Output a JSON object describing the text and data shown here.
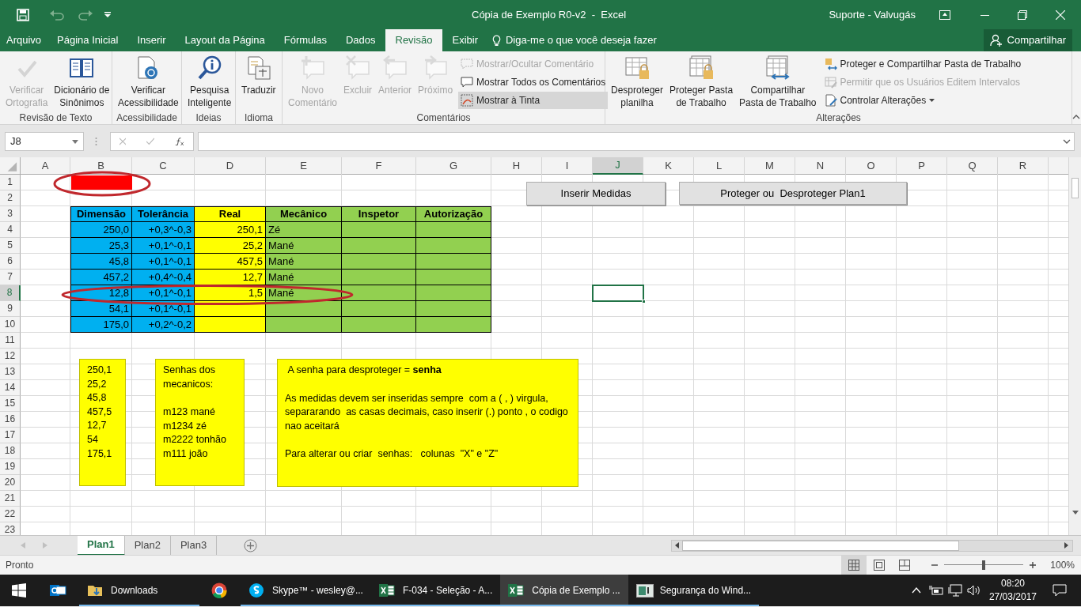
{
  "title_bar": {
    "title": "Cópia de Exemplo R0-v2  -  Excel",
    "account": "Suporte - Valvugás"
  },
  "menu_tabs": [
    {
      "label": "Arquivo",
      "selected": false
    },
    {
      "label": "Página Inicial",
      "selected": false
    },
    {
      "label": "Inserir",
      "selected": false
    },
    {
      "label": "Layout da Página",
      "selected": false
    },
    {
      "label": "Fórmulas",
      "selected": false
    },
    {
      "label": "Dados",
      "selected": false
    },
    {
      "label": "Revisão",
      "selected": true
    },
    {
      "label": "Exibir",
      "selected": false
    }
  ],
  "tell_me": "Diga-me o que você deseja fazer",
  "share_button": "Compartilhar",
  "ribbon_groups": [
    {
      "label": "Revisão de Texto",
      "commands": [
        {
          "lines": [
            "Verificar",
            "Ortografia"
          ],
          "disabled": true
        },
        {
          "lines": [
            "Dicionário de",
            "Sinônimos"
          ],
          "disabled": false
        }
      ]
    },
    {
      "label": "Acessibilidade",
      "commands": [
        {
          "lines": [
            "Verificar",
            "Acessibilidade"
          ],
          "disabled": false
        }
      ]
    },
    {
      "label": "Ideias",
      "commands": [
        {
          "lines": [
            "Pesquisa",
            "Inteligente"
          ],
          "disabled": false
        }
      ]
    },
    {
      "label": "Idioma",
      "commands": [
        {
          "lines": [
            "Traduzir"
          ],
          "disabled": false
        }
      ]
    },
    {
      "label": "Comentários",
      "commands": [
        {
          "lines": [
            "Novo",
            "Comentário"
          ],
          "disabled": true
        },
        {
          "lines": [
            "Excluir"
          ],
          "disabled": true
        },
        {
          "lines": [
            "Anterior"
          ],
          "disabled": true
        },
        {
          "lines": [
            "Próximo"
          ],
          "disabled": true
        }
      ],
      "stack": [
        {
          "label": "Mostrar/Ocultar Comentário",
          "disabled": true,
          "pressed": false,
          "dropdown": false
        },
        {
          "label": "Mostrar Todos os Comentários",
          "disabled": false,
          "pressed": false,
          "dropdown": false
        },
        {
          "label": "Mostrar à Tinta",
          "disabled": false,
          "pressed": true,
          "dropdown": false
        }
      ]
    },
    {
      "label": "Alterações",
      "commands": [
        {
          "lines": [
            "Desproteger",
            "planilha"
          ],
          "disabled": false
        },
        {
          "lines": [
            "Proteger Pasta",
            "de Trabalho"
          ],
          "disabled": false
        },
        {
          "lines": [
            "Compartilhar",
            "Pasta de Trabalho"
          ],
          "disabled": false
        }
      ],
      "stack": [
        {
          "label": "Proteger e Compartilhar Pasta de Trabalho",
          "disabled": false,
          "pressed": false,
          "dropdown": false
        },
        {
          "label": "Permitir que os Usuários Editem Intervalos",
          "disabled": true,
          "pressed": false,
          "dropdown": false
        },
        {
          "label": "Controlar Alterações",
          "disabled": false,
          "pressed": false,
          "dropdown": true
        }
      ]
    }
  ],
  "formula_bar": {
    "name_box": "J8"
  },
  "sheet": {
    "columns": [
      {
        "label": "A",
        "selected": false
      },
      {
        "label": "B",
        "selected": false
      },
      {
        "label": "C",
        "selected": false
      },
      {
        "label": "D",
        "selected": false
      },
      {
        "label": "E",
        "selected": false
      },
      {
        "label": "F",
        "selected": false
      },
      {
        "label": "G",
        "selected": false
      },
      {
        "label": "H",
        "selected": false
      },
      {
        "label": "I",
        "selected": false
      },
      {
        "label": "J",
        "selected": true
      },
      {
        "label": "K",
        "selected": false
      },
      {
        "label": "L",
        "selected": false
      },
      {
        "label": "M",
        "selected": false
      },
      {
        "label": "N",
        "selected": false
      },
      {
        "label": "O",
        "selected": false
      },
      {
        "label": "P",
        "selected": false
      },
      {
        "label": "Q",
        "selected": false
      },
      {
        "label": "R",
        "selected": false
      }
    ],
    "rows": [
      {
        "label": "1",
        "selected": false
      },
      {
        "label": "2",
        "selected": false
      },
      {
        "label": "3",
        "selected": false
      },
      {
        "label": "4",
        "selected": false
      },
      {
        "label": "5",
        "selected": false
      },
      {
        "label": "6",
        "selected": false
      },
      {
        "label": "7",
        "selected": false
      },
      {
        "label": "8",
        "selected": true
      },
      {
        "label": "9",
        "selected": false
      },
      {
        "label": "10",
        "selected": false
      },
      {
        "label": "11",
        "selected": false
      },
      {
        "label": "12",
        "selected": false
      },
      {
        "label": "13",
        "selected": false
      },
      {
        "label": "14",
        "selected": false
      },
      {
        "label": "15",
        "selected": false
      },
      {
        "label": "16",
        "selected": false
      },
      {
        "label": "17",
        "selected": false
      },
      {
        "label": "18",
        "selected": false
      },
      {
        "label": "19",
        "selected": false
      },
      {
        "label": "20",
        "selected": false
      },
      {
        "label": "21",
        "selected": false
      },
      {
        "label": "22",
        "selected": false
      },
      {
        "label": "23",
        "selected": false
      }
    ]
  },
  "table": {
    "columns": [
      {
        "title": "Dimensão",
        "color": "#00b0f0"
      },
      {
        "title": "Tolerância",
        "color": "#00b0f0"
      },
      {
        "title": "Real",
        "color": "#ffff00"
      },
      {
        "title": "Mecânico",
        "color": "#92d050"
      },
      {
        "title": "Inspetor",
        "color": "#92d050"
      },
      {
        "title": "Autorização",
        "color": "#92d050"
      }
    ],
    "rows": [
      {
        "cells": [
          "250,0",
          "+0,3^-0,3",
          "250,1",
          "Zé"
        ]
      },
      {
        "cells": [
          "25,3",
          "+0,1^-0,1",
          "25,2",
          "Mané"
        ]
      },
      {
        "cells": [
          "45,8",
          "+0,1^-0,1",
          "457,5",
          "Mané"
        ]
      },
      {
        "cells": [
          "457,2",
          "+0,4^-0,4",
          "12,7",
          "Mané"
        ]
      },
      {
        "cells": [
          "12,8",
          "+0,1^-0,1",
          "1,5",
          "Mané"
        ]
      },
      {
        "cells": [
          "54,1",
          "+0,1^-0,1"
        ]
      },
      {
        "cells": [
          "175,0",
          "+0,2^-0,2"
        ]
      }
    ]
  },
  "buttons": [
    "Inserir Medidas",
    "Proteger ou  Desproteger Plan1"
  ],
  "text_boxes": [
    {
      "paragraphs": [
        "250,1\n25,2\n45,8\n457,5\n12,7\n54\n175,1"
      ]
    },
    {
      "paragraphs": [
        "Senhas dos\nmecanicos:",
        "m123 mané\nm1234 zé\nm2222 tonhão\nm111 joão"
      ]
    },
    {
      "paragraphs": [
        " A senha para desproteger = **senha**",
        "As medidas devem ser inseridas sempre  com a ( , ) virgula, separarando  as casas decimais, caso inserir (.) ponto , o codigo nao aceitará",
        "Para alterar ou criar  senhas:   colunas  \"X\" e \"Z\""
      ]
    }
  ],
  "sheet_tabs": [
    {
      "label": "Plan1",
      "selected": true
    },
    {
      "label": "Plan2",
      "selected": false
    },
    {
      "label": "Plan3",
      "selected": false
    }
  ],
  "status_bar": {
    "status": "Pronto",
    "views": [
      {
        "selected": true
      },
      {
        "selected": false
      },
      {
        "selected": false
      }
    ],
    "zoom": {
      "level": 0.5,
      "reading": "100%"
    }
  },
  "taskbar": {
    "items": [
      {
        "open": false,
        "selected": false
      },
      {
        "label": "Downloads",
        "open": true,
        "selected": false
      },
      {
        "open": false,
        "selected": false
      },
      {
        "label": "Skype™ - wesley@...",
        "open": true,
        "selected": false
      },
      {
        "label": "F-034 - Seleção - A...",
        "open": true,
        "selected": false
      },
      {
        "label": "Cópia de Exemplo ...",
        "open": true,
        "selected": true
      },
      {
        "label": "Segurança do Wind...",
        "open": true,
        "selected": false
      }
    ],
    "clock": {
      "time": "08:20",
      "date": "27/03/2017"
    }
  }
}
